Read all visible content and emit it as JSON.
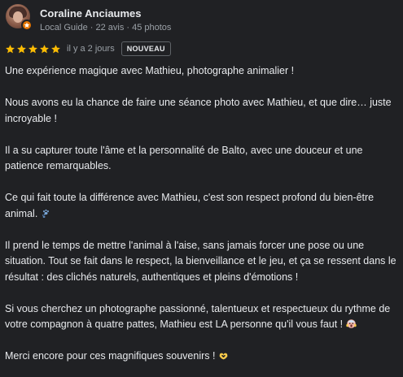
{
  "reviewer": {
    "name": "Coraline Anciaumes",
    "subline": "Local Guide · 22 avis · 45 photos"
  },
  "review": {
    "rating": 5,
    "time": "il y a 2 jours",
    "badge": "NOUVEAU",
    "paragraphs": [
      "Une expérience magique avec Mathieu, photographe animalier !",
      "Nous avons eu la chance de faire une séance photo avec Mathieu, et que dire… juste incroyable !",
      "Il a su capturer toute l'âme et la personnalité de Balto, avec une douceur et une patience remarquables.",
      "Ce qui fait toute la différence avec Mathieu, c'est son respect profond du bien-être animal.",
      "Il prend le temps de mettre l'animal à l'aise, sans jamais forcer une pose ou une situation. Tout se fait dans le respect, la bienveillance et le jeu, et ça se ressent dans le résultat : des clichés naturels, authentiques et pleins d'émotions !",
      "Si vous cherchez un photographe passionné, talentueux et respectueux du rythme de votre compagnon à quatre pattes, Mathieu est LA personne qu'il vous faut !",
      "Merci encore pour ces magnifiques souvenirs !"
    ]
  },
  "icons": {
    "star": "star-icon",
    "local_guide": "local-guide-badge-icon",
    "paw": "paw-prints-emoji-icon",
    "shocked": "screaming-face-emoji-icon",
    "heart_hands": "heart-hands-emoji-icon"
  },
  "colors": {
    "background": "#202124",
    "star": "#fbbc04",
    "guide_badge": "#e37400",
    "secondary_text": "#9aa0a6"
  }
}
